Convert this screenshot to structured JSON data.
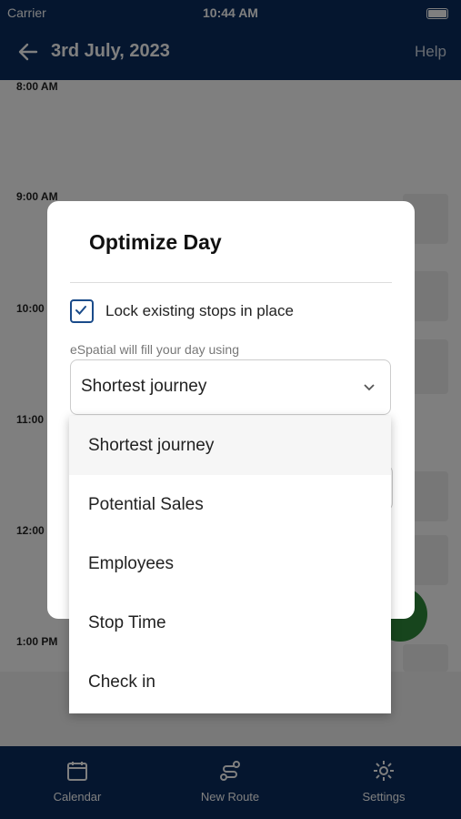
{
  "status_bar": {
    "carrier": "Carrier",
    "time": "10:44 AM"
  },
  "header": {
    "title": "3rd July, 2023",
    "help_label": "Help",
    "back_icon": "arrow-left-icon"
  },
  "calendar": {
    "times": [
      "8:00 AM",
      "9:00 AM",
      "10:00",
      "11:00",
      "12:00",
      "1:00 PM"
    ]
  },
  "tab_bar": {
    "tabs": [
      {
        "label": "Calendar",
        "icon": "calendar-icon"
      },
      {
        "label": "New Route",
        "icon": "route-icon"
      },
      {
        "label": "Settings",
        "icon": "gear-icon"
      }
    ]
  },
  "modal": {
    "title": "Optimize Day",
    "lock_label": "Lock existing stops in place",
    "lock_checked": true,
    "hint": "eSpatial will fill your day using",
    "selected_value": "Shortest journey",
    "options": [
      "Shortest journey",
      "Potential Sales",
      "Employees",
      "Stop Time",
      "Check in"
    ]
  },
  "colors": {
    "navy": "#0a2d5f",
    "accent_blue": "#1a4b8a",
    "green": "#2e8b3a"
  }
}
